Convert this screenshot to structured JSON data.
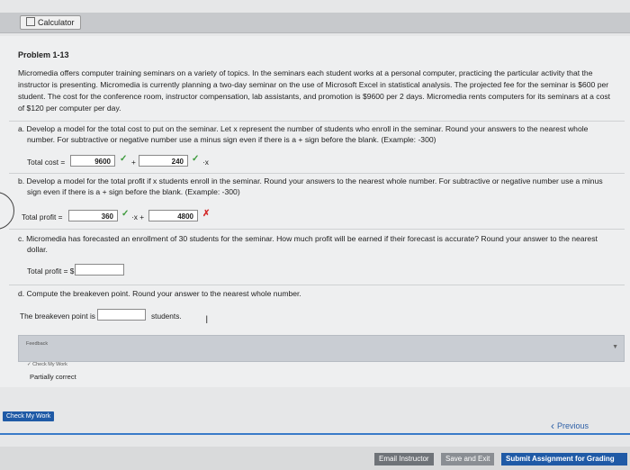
{
  "toolbar": {
    "calculator_label": "Calculator"
  },
  "problem": {
    "title": "Problem 1-13",
    "intro": [
      "Micromedia offers computer training seminars on a variety of topics. In the seminars each student works at a personal computer, practicing the particular activity that the",
      "instructor is presenting. Micromedia is currently planning a two-day seminar on the use of Microsoft Excel in statistical analysis. The projected fee for the seminar is $600 per",
      "student. The cost for the conference room, instructor compensation, lab assistants, and promotion is $9600 per 2 days. Micromedia rents computers for its seminars at a cost",
      "of $120 per computer per day."
    ]
  },
  "part_a": {
    "question": [
      "a.  Develop a model for the total cost to put on the seminar. Let x represent the number of students who enroll in the seminar. Round your answers to the nearest whole",
      "number. For subtractive or negative number use a minus sign even if there is a + sign before the blank. (Example: -300)"
    ],
    "label": "Total cost =",
    "value1": "9600",
    "plus": "+",
    "value2": "240",
    "suffix": "·x"
  },
  "part_b": {
    "question": [
      "b.  Develop a model for the total profit if x students enroll in the seminar. Round your answers to the nearest whole number. For subtractive or negative number use a minus",
      "sign even if there is a + sign before the blank. (Example: -300)"
    ],
    "label": "Total profit =",
    "value1": "360",
    "mid": "·x +",
    "value2": "4800"
  },
  "part_c": {
    "question": [
      "c.  Micromedia has forecasted an enrollment of 30 students for the seminar. How much profit will be earned if their forecast is accurate? Round your answer to the nearest",
      "dollar."
    ],
    "label": "Total profit = $",
    "value": ""
  },
  "part_d": {
    "question": "d.  Compute the breakeven point. Round your answer to the nearest whole number.",
    "label": "The breakeven point is",
    "value": "",
    "unit": "students."
  },
  "feedback": {
    "label": "Feedback",
    "check_my_work_small": "Check My Work",
    "status": "Partially correct"
  },
  "nav": {
    "check_my_work": "Check My Work",
    "previous": "Previous",
    "email_instructor": "Email Instructor",
    "save_and_exit": "Save and Exit",
    "submit": "Submit Assignment for Grading"
  }
}
